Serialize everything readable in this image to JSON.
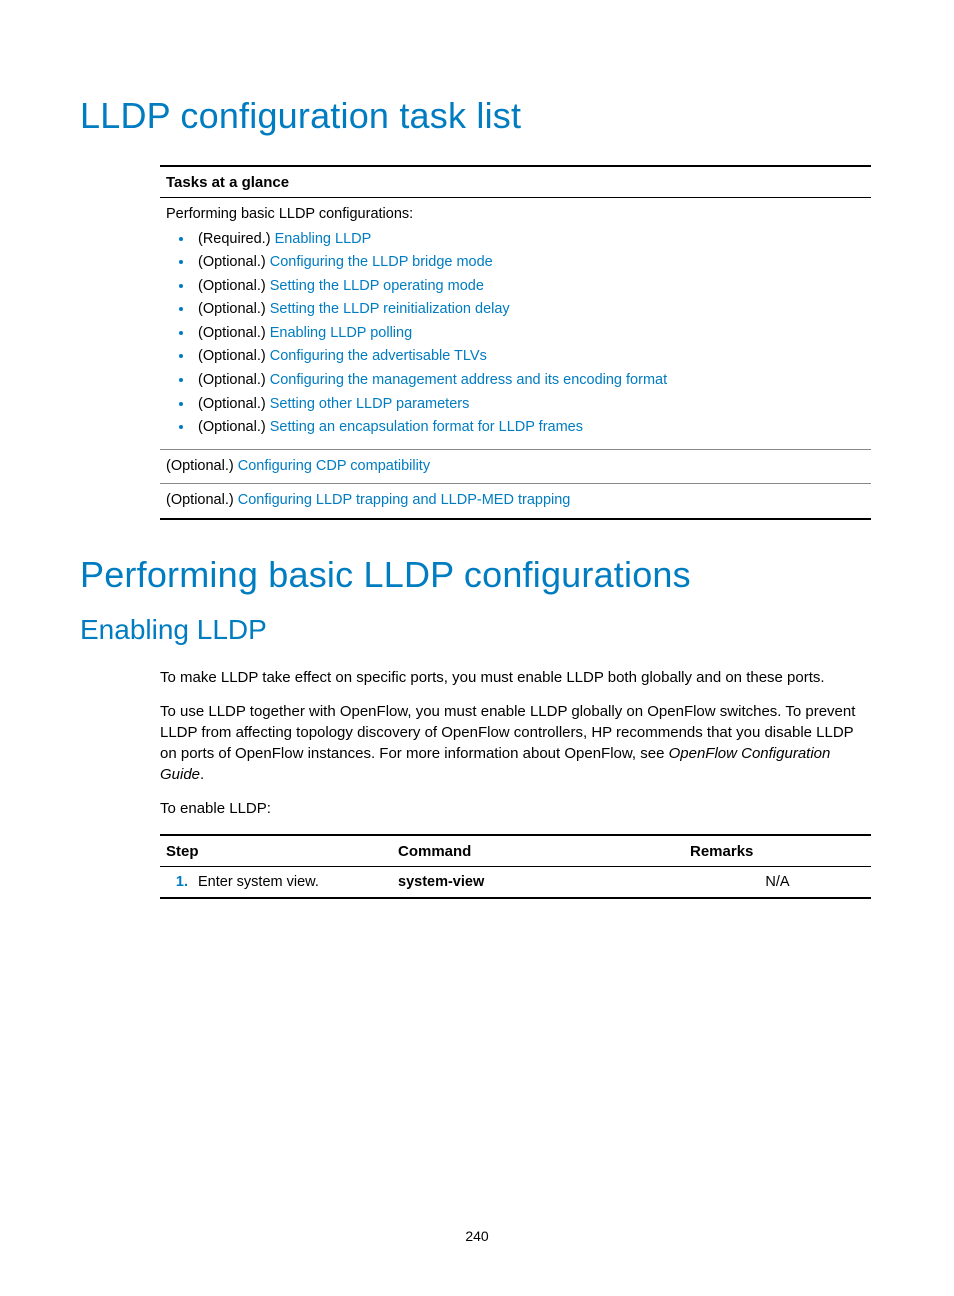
{
  "headings": {
    "h1a": "LLDP configuration task list",
    "h1b": "Performing basic LLDP configurations",
    "h2": "Enabling LLDP"
  },
  "tasks": {
    "header": "Tasks at a glance",
    "intro": "Performing basic LLDP configurations:",
    "items": [
      {
        "prefix": "(Required.) ",
        "link": "Enabling LLDP"
      },
      {
        "prefix": "(Optional.) ",
        "link": "Configuring the LLDP bridge mode"
      },
      {
        "prefix": "(Optional.) ",
        "link": "Setting the LLDP operating mode"
      },
      {
        "prefix": "(Optional.) ",
        "link": "Setting the LLDP reinitialization delay"
      },
      {
        "prefix": "(Optional.) ",
        "link": "Enabling LLDP polling"
      },
      {
        "prefix": "(Optional.) ",
        "link": "Configuring the advertisable TLVs"
      },
      {
        "prefix": "(Optional.) ",
        "link": "Configuring the management address and its encoding format"
      },
      {
        "prefix": "(Optional.) ",
        "link": "Setting other LLDP parameters"
      },
      {
        "prefix": "(Optional.) ",
        "link": "Setting an encapsulation format for LLDP frames"
      }
    ],
    "row2_prefix": "(Optional.) ",
    "row2_link": "Configuring CDP compatibility",
    "row3_prefix": "(Optional.) ",
    "row3_link": "Configuring LLDP trapping and LLDP-MED trapping"
  },
  "body": {
    "p1": "To make LLDP take effect on specific ports, you must enable LLDP both globally and on these ports.",
    "p2a": "To use LLDP together with OpenFlow, you must enable LLDP globally on OpenFlow switches. To prevent LLDP from affecting topology discovery of OpenFlow controllers, HP recommends that you disable LLDP on ports of OpenFlow instances. For more information about OpenFlow, see ",
    "p2i": "OpenFlow Configuration Guide",
    "p2b": ".",
    "p3": "To enable LLDP:"
  },
  "steps": {
    "headers": {
      "step": "Step",
      "command": "Command",
      "remarks": "Remarks"
    },
    "rows": [
      {
        "num": "1.",
        "desc": "Enter system view.",
        "command": "system-view",
        "remarks": "N/A"
      }
    ]
  },
  "page_number": "240"
}
